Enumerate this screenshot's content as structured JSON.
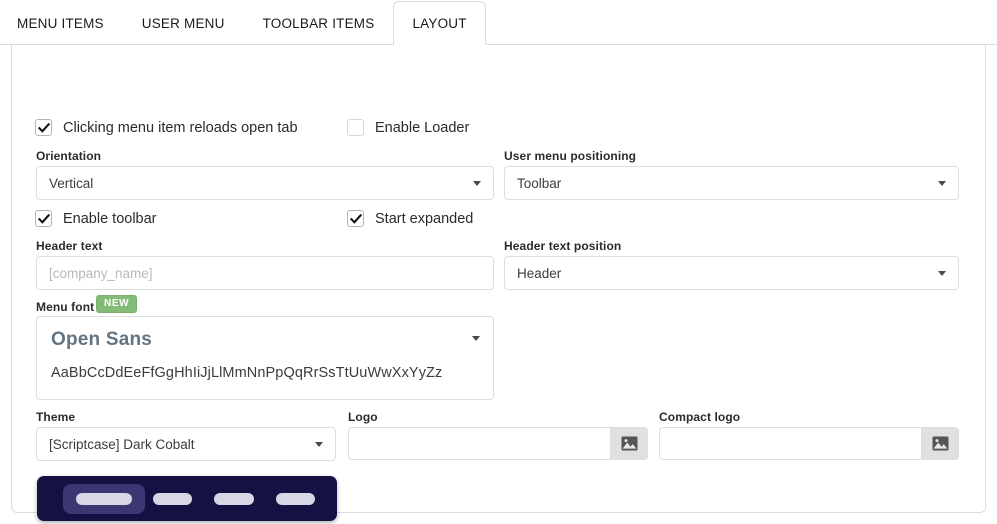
{
  "tabs": [
    {
      "label": "MENU ITEMS",
      "active": false
    },
    {
      "label": "USER MENU",
      "active": false
    },
    {
      "label": "TOOLBAR ITEMS",
      "active": false
    },
    {
      "label": "LAYOUT",
      "active": true
    }
  ],
  "form": {
    "reload_tab_checkbox": {
      "label": "Clicking menu item reloads open tab",
      "checked": true
    },
    "enable_loader_checkbox": {
      "label": "Enable Loader",
      "checked": false
    },
    "orientation": {
      "label": "Orientation",
      "value": "Vertical"
    },
    "user_menu_positioning": {
      "label": "User menu positioning",
      "value": "Toolbar"
    },
    "enable_toolbar_checkbox": {
      "label": "Enable toolbar",
      "checked": true
    },
    "start_expanded_checkbox": {
      "label": "Start expanded",
      "checked": true
    },
    "header_text": {
      "label": "Header text",
      "value": "",
      "placeholder": "[company_name]"
    },
    "header_text_position": {
      "label": "Header text position",
      "value": "Header"
    },
    "menu_font": {
      "label": "Menu font",
      "badge": "NEW",
      "value": "Open Sans",
      "sample": "AaBbCcDdEeFfGgHhIiJjLlMmNnPpQqRrSsTtUuWwXxYyZz"
    },
    "theme": {
      "label": "Theme",
      "value": "[Scriptcase] Dark Cobalt"
    },
    "logo": {
      "label": "Logo",
      "value": "",
      "browse_icon": "image-icon"
    },
    "compact_logo": {
      "label": "Compact logo",
      "value": "",
      "browse_icon": "image-icon"
    }
  },
  "theme_preview": {
    "background_color": "#151243",
    "active_pill_color": "#3c3673",
    "bar_color": "#d7d7e6",
    "items": 4
  },
  "colors": {
    "badge_green": "#85bb78",
    "panel_border": "#dcdcdc",
    "field_border": "#dedede",
    "label_text": "#2b2b2b",
    "font_name_text": "#637482",
    "placeholder_text": "#b9b9b9"
  }
}
